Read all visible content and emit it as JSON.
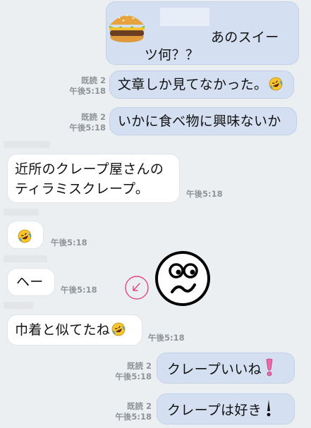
{
  "messages": {
    "m1": {
      "text_line1": "あのスイー",
      "text_line2": "ツ何？？"
    },
    "m2": {
      "read": "既読 2",
      "time": "午後5:18",
      "text": "文章しか見てなかった。"
    },
    "m3": {
      "read": "既読 2",
      "time": "午後5:18",
      "text": "いかに食べ物に興味ないか"
    },
    "m4": {
      "line1": "近所のクレープ屋さんの",
      "line2": "ティラミスクレープ。",
      "time": "午後5:18"
    },
    "m5": {
      "time": "午後5:18"
    },
    "m6": {
      "text": "ヘー",
      "time": "午後5:18"
    },
    "m7": {
      "text": "巾着と似てたね",
      "time": "午後5:18"
    },
    "m8": {
      "read": "既読 2",
      "time": "午後5:18",
      "text": "クレープいいね"
    },
    "m9": {
      "read": "既読 2",
      "time": "午後5:18",
      "text": "クレープは好き"
    }
  },
  "icons": {
    "laugh": "rolling-on-floor-laughing-emoji",
    "burger": "hamburger-sticker",
    "face": "worried-face-drawing",
    "check": "circle-arrow-mark"
  },
  "colors": {
    "outgoing_bubble": "#d4e0f2",
    "incoming_bubble": "#ffffff",
    "background": "#eceff1",
    "exclamation_pink": "#e86aa6",
    "annotation_pink": "#e0457b"
  }
}
